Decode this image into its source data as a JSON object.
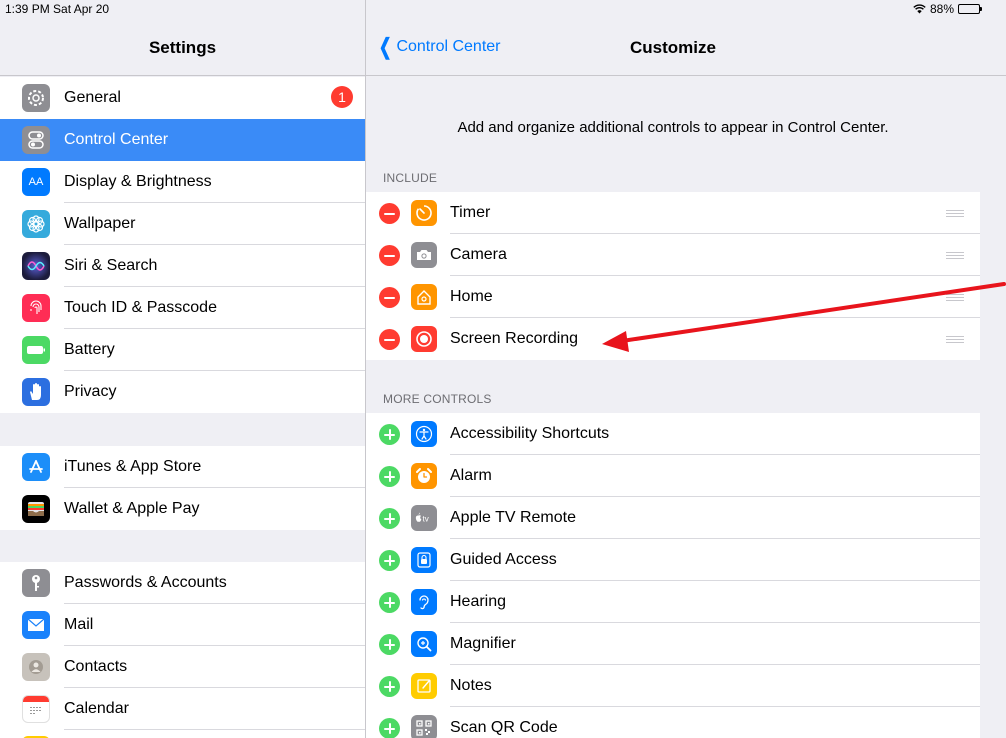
{
  "status_bar": {
    "time_date": "1:39 PM  Sat Apr 20",
    "battery_percent": "88%",
    "battery_level": 0.88
  },
  "sidebar": {
    "title": "Settings",
    "groups": [
      {
        "items": [
          {
            "label": "General",
            "icon": "gear-icon",
            "color": "#8e8e93",
            "badge": "1"
          },
          {
            "label": "Control Center",
            "icon": "switches-icon",
            "color": "#8e8e93",
            "selected": true
          },
          {
            "label": "Display & Brightness",
            "icon": "text-size-icon",
            "color": "#007aff",
            "glyph": "AA"
          },
          {
            "label": "Wallpaper",
            "icon": "flower-icon",
            "color": "#35aadc"
          },
          {
            "label": "Siri & Search",
            "icon": "siri-icon",
            "color": "#1c1c3c"
          },
          {
            "label": "Touch ID & Passcode",
            "icon": "fingerprint-icon",
            "color": "#ff2d55"
          },
          {
            "label": "Battery",
            "icon": "battery-icon",
            "color": "#4cd964"
          },
          {
            "label": "Privacy",
            "icon": "hand-icon",
            "color": "#2c6fe0"
          }
        ]
      },
      {
        "items": [
          {
            "label": "iTunes & App Store",
            "icon": "app-store-icon",
            "color": "#1c8ef9"
          },
          {
            "label": "Wallet & Apple Pay",
            "icon": "wallet-icon",
            "color": "#000000"
          }
        ]
      },
      {
        "items": [
          {
            "label": "Passwords & Accounts",
            "icon": "key-icon",
            "color": "#8e8e93"
          },
          {
            "label": "Mail",
            "icon": "envelope-icon",
            "color": "#1a82fb"
          },
          {
            "label": "Contacts",
            "icon": "contacts-icon",
            "color": "#b9b3ab"
          },
          {
            "label": "Calendar",
            "icon": "calendar-icon",
            "color": "#ffffff"
          }
        ]
      }
    ]
  },
  "main": {
    "back_label": "Control Center",
    "title": "Customize",
    "description": "Add and organize additional controls to appear in Control Center.",
    "include_header": "INCLUDE",
    "include_items": [
      {
        "label": "Timer",
        "icon": "timer-icon",
        "color": "#ff9500"
      },
      {
        "label": "Camera",
        "icon": "camera-icon",
        "color": "#8e8e93"
      },
      {
        "label": "Home",
        "icon": "home-icon",
        "color": "#ff9500"
      },
      {
        "label": "Screen Recording",
        "icon": "record-icon",
        "color": "#ff3b30"
      }
    ],
    "more_header": "MORE CONTROLS",
    "more_items": [
      {
        "label": "Accessibility Shortcuts",
        "icon": "accessibility-icon",
        "color": "#007aff"
      },
      {
        "label": "Alarm",
        "icon": "alarm-icon",
        "color": "#ff9500"
      },
      {
        "label": "Apple TV Remote",
        "icon": "apple-tv-icon",
        "color": "#8e8e93",
        "glyph": "tv"
      },
      {
        "label": "Guided Access",
        "icon": "guided-access-icon",
        "color": "#007aff"
      },
      {
        "label": "Hearing",
        "icon": "ear-icon",
        "color": "#007aff"
      },
      {
        "label": "Magnifier",
        "icon": "magnifier-icon",
        "color": "#007aff"
      },
      {
        "label": "Notes",
        "icon": "notes-icon",
        "color": "#ffcc00"
      },
      {
        "label": "Scan QR Code",
        "icon": "qr-code-icon",
        "color": "#8e8e93"
      }
    ]
  },
  "annotation": {
    "color": "#e8141c"
  }
}
